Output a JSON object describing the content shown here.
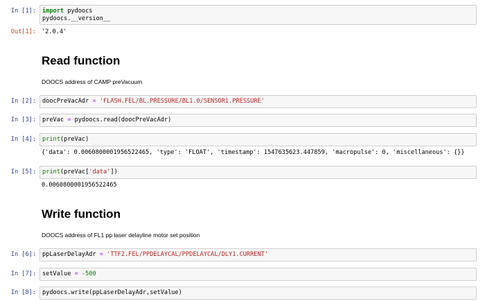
{
  "cells": [
    {
      "prompt": "In [1]:",
      "line1_kw": "import",
      "line1_rest": " pydoocs",
      "line2": "pydoocs.__version__"
    },
    {
      "prompt": "Out[1]:",
      "output": "'2.0.4'"
    },
    {
      "heading": "Read function"
    },
    {
      "text": "DOOCS address of CAMP preVacuum"
    },
    {
      "prompt": "In [2]:",
      "var": "doocPreVacAdr",
      "op": " = ",
      "str": "'FLASH.FEL/BL.PRESSURE/BL1.0/SENSOR1.PRESSURE'"
    },
    {
      "prompt": "In [3]:",
      "code": "preVac = pydoocs.read(doocPreVacAdr)",
      "pre": "preVac ",
      "op": "=",
      "post": " pydoocs.read(doocPreVacAdr)"
    },
    {
      "prompt": "In [4]:",
      "fn": "print",
      "args": "(preVac)"
    },
    {
      "output": "{'data': 0.0060800001956522465, 'type': 'FLOAT', 'timestamp': 1547635623.447859, 'macropulse': 0, 'miscellaneous': {}}"
    },
    {
      "prompt": "In [5]:",
      "fn": "print",
      "arg_pre": "(preVac[",
      "arg_str": "'data'",
      "arg_post": "])"
    },
    {
      "output": "0.0060800001956522465"
    },
    {
      "heading": "Write function"
    },
    {
      "text": "DOOCS address of FL1 pp laser delayline motor set position"
    },
    {
      "prompt": "In [6]:",
      "var": "ppLaserDelayAdr",
      "op": " = ",
      "str": "'TTF2.FEL/PPDELAYCAL/PPDELAYCAL/DLY1.CURRENT'"
    },
    {
      "prompt": "In [7]:",
      "var": "setValue",
      "op": " = ",
      "num": "-500"
    },
    {
      "prompt": "In [8]:",
      "code": "pydoocs.write(ppLaserDelayAdr,setValue)"
    }
  ]
}
